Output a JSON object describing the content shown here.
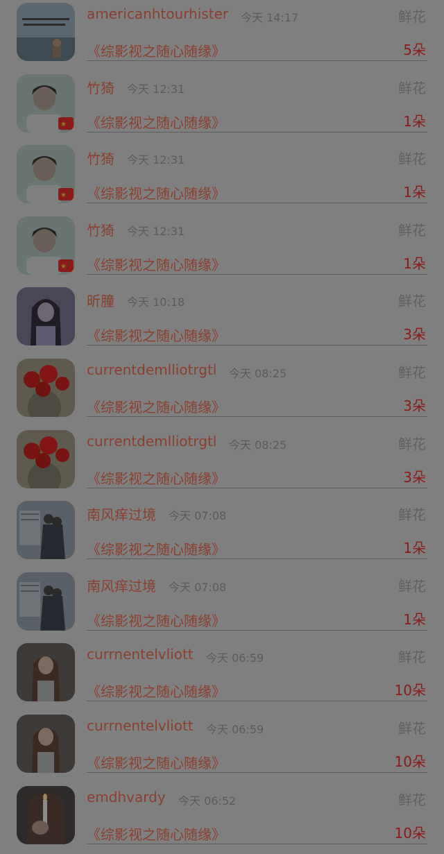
{
  "rows": [
    {
      "name": "americanhtourhister",
      "time": "今天 14:17",
      "gift_type": "鲜花",
      "book": "《综影视之随心随缘》",
      "count": "5朵",
      "avatar": "landscape-avatar"
    },
    {
      "name": "竹猗",
      "time": "今天 12:31",
      "gift_type": "鲜花",
      "book": "《综影视之随心随缘》",
      "count": "1朵",
      "avatar": "boy-flag-avatar"
    },
    {
      "name": "竹猗",
      "time": "今天 12:31",
      "gift_type": "鲜花",
      "book": "《综影视之随心随缘》",
      "count": "1朵",
      "avatar": "boy-flag-avatar"
    },
    {
      "name": "竹猗",
      "time": "今天 12:31",
      "gift_type": "鲜花",
      "book": "《综影视之随心随缘》",
      "count": "1朵",
      "avatar": "boy-flag-avatar"
    },
    {
      "name": "昕朣",
      "time": "今天 10:18",
      "gift_type": "鲜花",
      "book": "《综影视之随心随缘》",
      "count": "3朵",
      "avatar": "anime-girl-avatar"
    },
    {
      "name": "currentdemlliotrgtl",
      "time": "今天 08:25",
      "gift_type": "鲜花",
      "book": "《综影视之随心随缘》",
      "count": "3朵",
      "avatar": "cactus-flower-avatar"
    },
    {
      "name": "currentdemlliotrgtl",
      "time": "今天 08:25",
      "gift_type": "鲜花",
      "book": "《综影视之随心随缘》",
      "count": "3朵",
      "avatar": "cactus-flower-avatar"
    },
    {
      "name": "南风痒过境",
      "time": "今天 07:08",
      "gift_type": "鲜花",
      "book": "《综影视之随心随缘》",
      "count": "1朵",
      "avatar": "couple-avatar"
    },
    {
      "name": "南风痒过境",
      "time": "今天 07:08",
      "gift_type": "鲜花",
      "book": "《综影视之随心随缘》",
      "count": "1朵",
      "avatar": "couple-avatar"
    },
    {
      "name": "currnentelvliott",
      "time": "今天 06:59",
      "gift_type": "鲜花",
      "book": "《综影视之随心随缘》",
      "count": "10朵",
      "avatar": "woman-portrait-avatar"
    },
    {
      "name": "currnentelvliott",
      "time": "今天 06:59",
      "gift_type": "鲜花",
      "book": "《综影视之随心随缘》",
      "count": "10朵",
      "avatar": "woman-portrait-avatar"
    },
    {
      "name": "emdhvardy",
      "time": "今天 06:52",
      "gift_type": "鲜花",
      "book": "《综影视之随心随缘》",
      "count": "10朵",
      "avatar": "candle-woman-avatar"
    }
  ]
}
